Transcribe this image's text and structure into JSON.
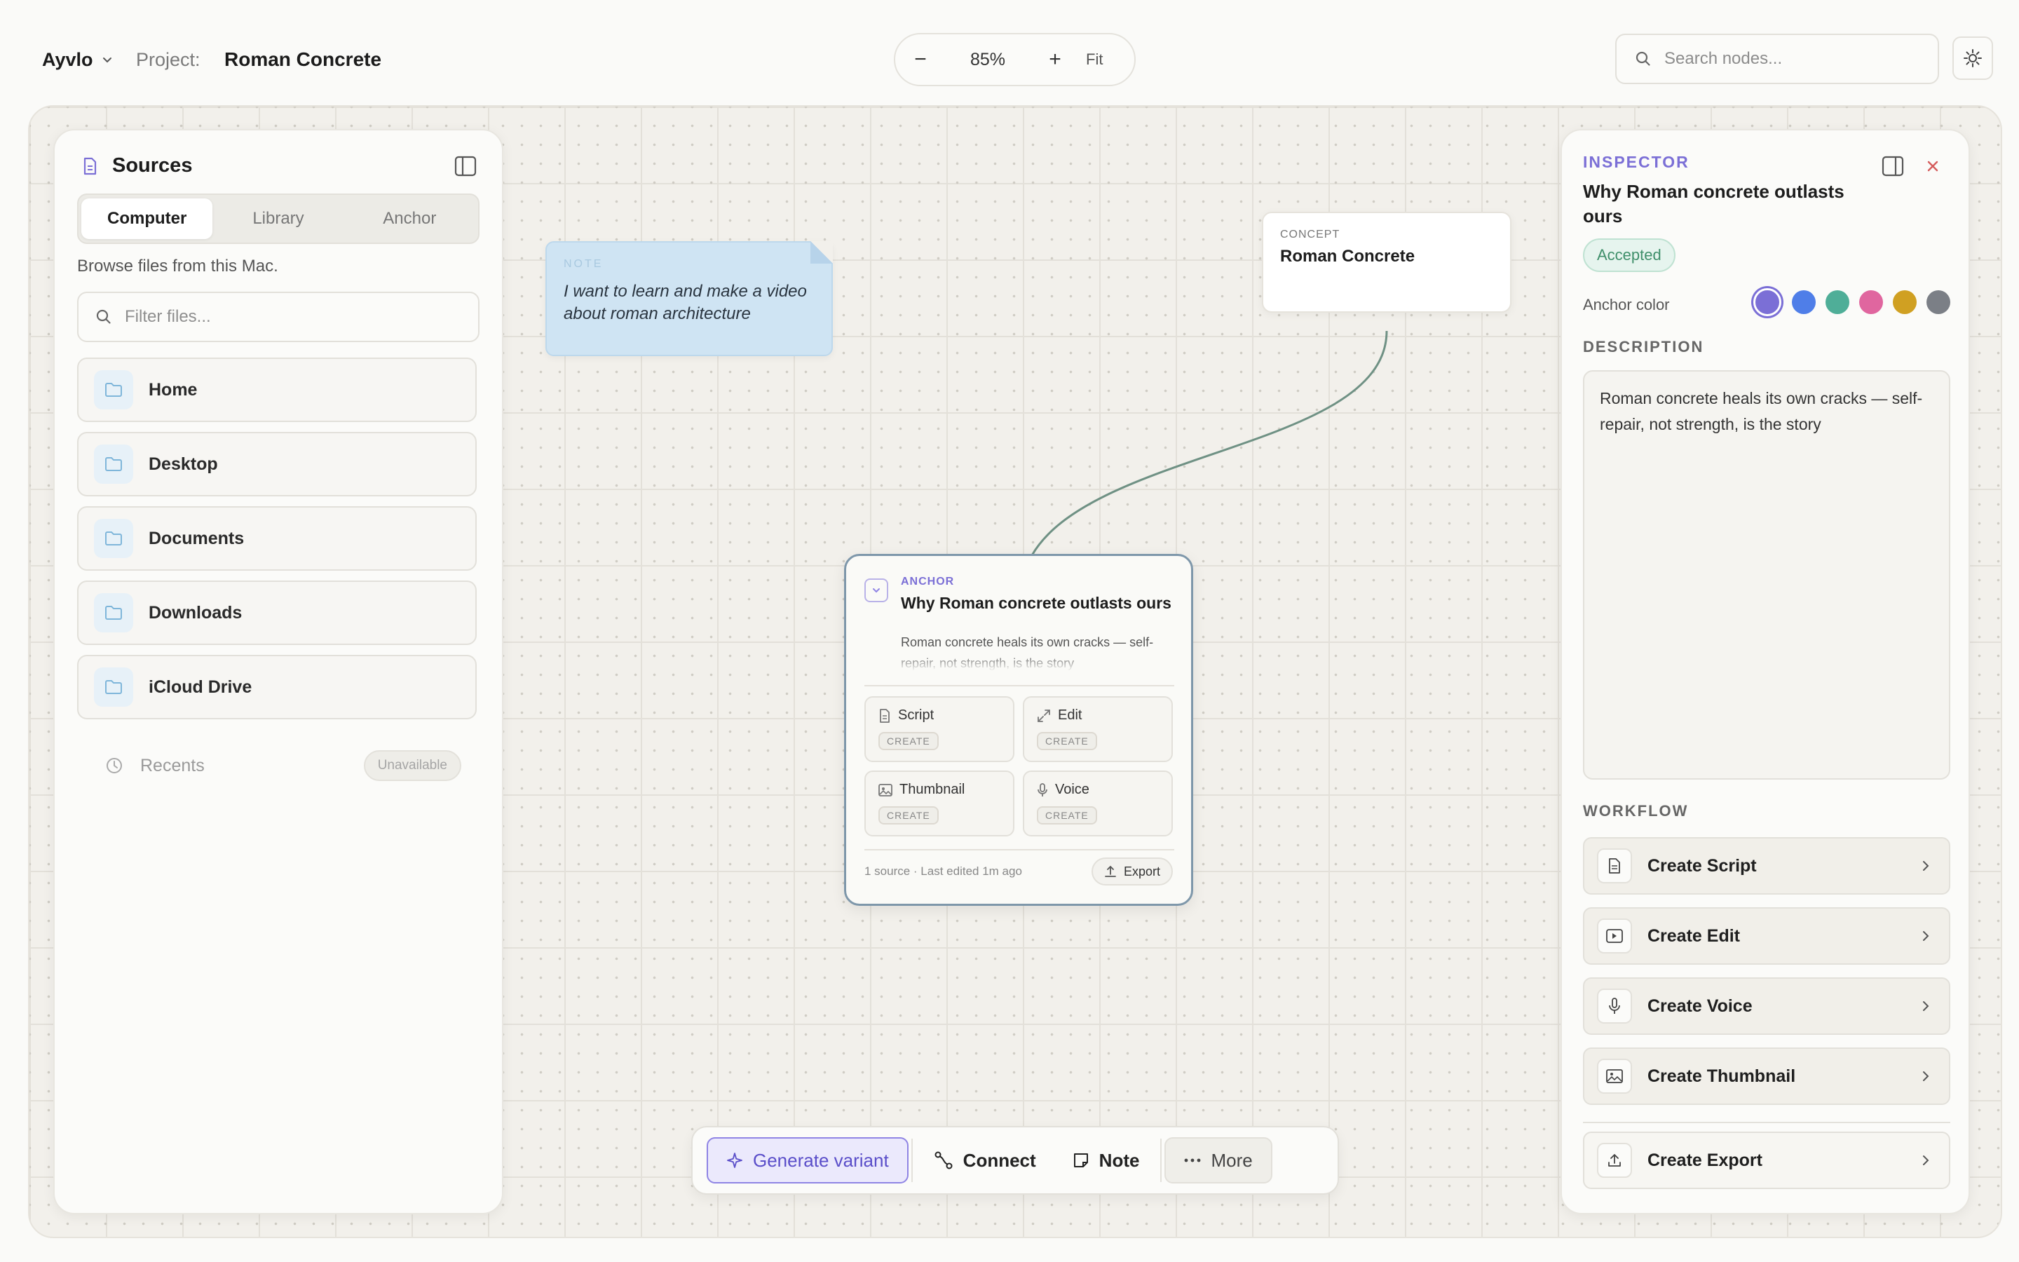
{
  "header": {
    "brand": "Ayvlo",
    "project_label": "Project:",
    "project_name": "Roman Concrete",
    "zoom": {
      "minus": "−",
      "value": "85%",
      "plus": "+",
      "fit": "Fit"
    },
    "search_placeholder": "Search nodes..."
  },
  "sources": {
    "title": "Sources",
    "tabs": [
      "Computer",
      "Library",
      "Anchor"
    ],
    "active_tab": "Computer",
    "browse_hint": "Browse files from this Mac.",
    "filter_placeholder": "Filter files...",
    "folders": [
      "Home",
      "Desktop",
      "Documents",
      "Downloads",
      "iCloud Drive"
    ],
    "recents_label": "Recents",
    "recents_status": "Unavailable"
  },
  "note": {
    "tag": "NOTE",
    "text": "I want to learn and make a video about roman architecture"
  },
  "concept": {
    "tag": "CONCEPT",
    "title": "Roman Concrete"
  },
  "anchor": {
    "tag": "ANCHOR",
    "title": "Why Roman concrete outlasts ours",
    "description": "Roman concrete heals its own cracks — self-repair, not strength, is the story",
    "actions": [
      {
        "label": "Script",
        "badge": "CREATE",
        "icon": "document-icon"
      },
      {
        "label": "Edit",
        "badge": "CREATE",
        "icon": "expand-icon"
      },
      {
        "label": "Thumbnail",
        "badge": "CREATE",
        "icon": "image-icon"
      },
      {
        "label": "Voice",
        "badge": "CREATE",
        "icon": "mic-icon"
      }
    ],
    "footer": "1 source  ·  Last edited 1m ago",
    "export_label": "Export"
  },
  "inspector": {
    "tag": "INSPECTOR",
    "title": "Why Roman concrete outlasts ours",
    "status": "Accepted",
    "anchor_color_label": "Anchor color",
    "colors": [
      "#7b6fd6",
      "#4f7ee8",
      "#4fae98",
      "#e0669f",
      "#d0a022",
      "#7b7f86"
    ],
    "selected_color": "#7b6fd6",
    "description_label": "DESCRIPTION",
    "description": "Roman concrete heals its own cracks — self-repair, not strength, is the story",
    "workflow_label": "WORKFLOW",
    "workflow": [
      {
        "label": "Create Script",
        "icon": "document-icon"
      },
      {
        "label": "Create Edit",
        "icon": "video-icon"
      },
      {
        "label": "Create Voice",
        "icon": "mic-icon"
      },
      {
        "label": "Create Thumbnail",
        "icon": "image-icon"
      },
      {
        "label": "Create Export",
        "icon": "upload-icon"
      }
    ]
  },
  "toolbar": {
    "generate": "Generate variant",
    "connect": "Connect",
    "note": "Note",
    "more": "More"
  }
}
